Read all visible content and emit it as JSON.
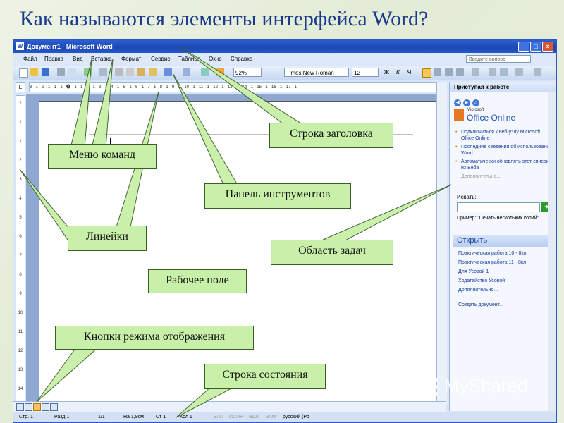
{
  "slide": {
    "title": "Как называются элементы интерфейса Word?"
  },
  "window": {
    "title": "Документ1 - Microsoft Word",
    "app_icon": "W",
    "minimize": "_",
    "maximize": "□",
    "close": "×"
  },
  "menubar": {
    "items": [
      "Файл",
      "Правка",
      "Вид",
      "Вставка",
      "Формат",
      "Сервис",
      "Таблица",
      "Окно",
      "Справка"
    ],
    "help_placeholder": "Введите вопрос"
  },
  "toolbar": {
    "zoom": "92%",
    "font_name": "Times New Roman",
    "font_size": "12",
    "bold": "Ж",
    "italic": "К",
    "underline": "Ч"
  },
  "ruler": {
    "horizontal": "3 · 1 · 2 · 1 · 1 · 1 · 🅧 · 1 · 1 · 2 · 1 · 3 · 1 · 4 · 1 · 5 · 1 · 6 · 1 · 7 · 1 · 8 · 1 · 9 · 1 · 10 · 1 · 11 · 1 · 12 · 1 · 13 · 1 · 14 · 1 · 15 · 1 · 16 · 1 · 17 · 1",
    "vertical": [
      "2",
      "1",
      "1",
      "2",
      "3",
      "4",
      "5",
      "6",
      "7",
      "8",
      "9",
      "10",
      "11",
      "12",
      "13",
      "14"
    ]
  },
  "statusbar": {
    "page": "Стр. 1",
    "section": "Разд 1",
    "pages": "1/1",
    "at": "На 1,9см",
    "line": "Ст 1",
    "col": "Кол 1",
    "rec": "ЗАП",
    "trk": "ИСПР",
    "ext": "ВДЛ",
    "ovr": "ЗАМ",
    "lang": "русский (Ро"
  },
  "taskpane": {
    "title": "Приступая к работе",
    "logo_small": "Microsoft",
    "logo_big": "Office Online",
    "bullets": [
      "Подключиться к веб-узлу Microsoft Office Online",
      "Последние сведения об использовании Word",
      "Автоматически обновлять этот список из Веба"
    ],
    "more": "Дополнительно...",
    "search_label": "Искать:",
    "example": "Пример: \"Печать нескольких копий\"",
    "open_title": "Открыть",
    "open_items": [
      "Практическая работа 10 - 8кл",
      "Практическая работа 11 - 8кл",
      "Для Усовой 1",
      "Ходатайство Усовой",
      "Дополнительно..."
    ],
    "create": "Создать документ..."
  },
  "callouts": {
    "title_bar": "Строка заголовка",
    "menu": "Меню команд",
    "toolbar": "Панель инструментов",
    "rulers": "Линейки",
    "task_pane": "Область задач",
    "workspace": "Рабочее поле",
    "view_buttons": "Кнопки режима отображения",
    "status_bar": "Строка состояния"
  },
  "watermark": "MyShared",
  "colors": {
    "callout_fill": "#c8f0a8",
    "title_color": "#1a3a8a",
    "titlebar_blue": "#1d47b4"
  }
}
